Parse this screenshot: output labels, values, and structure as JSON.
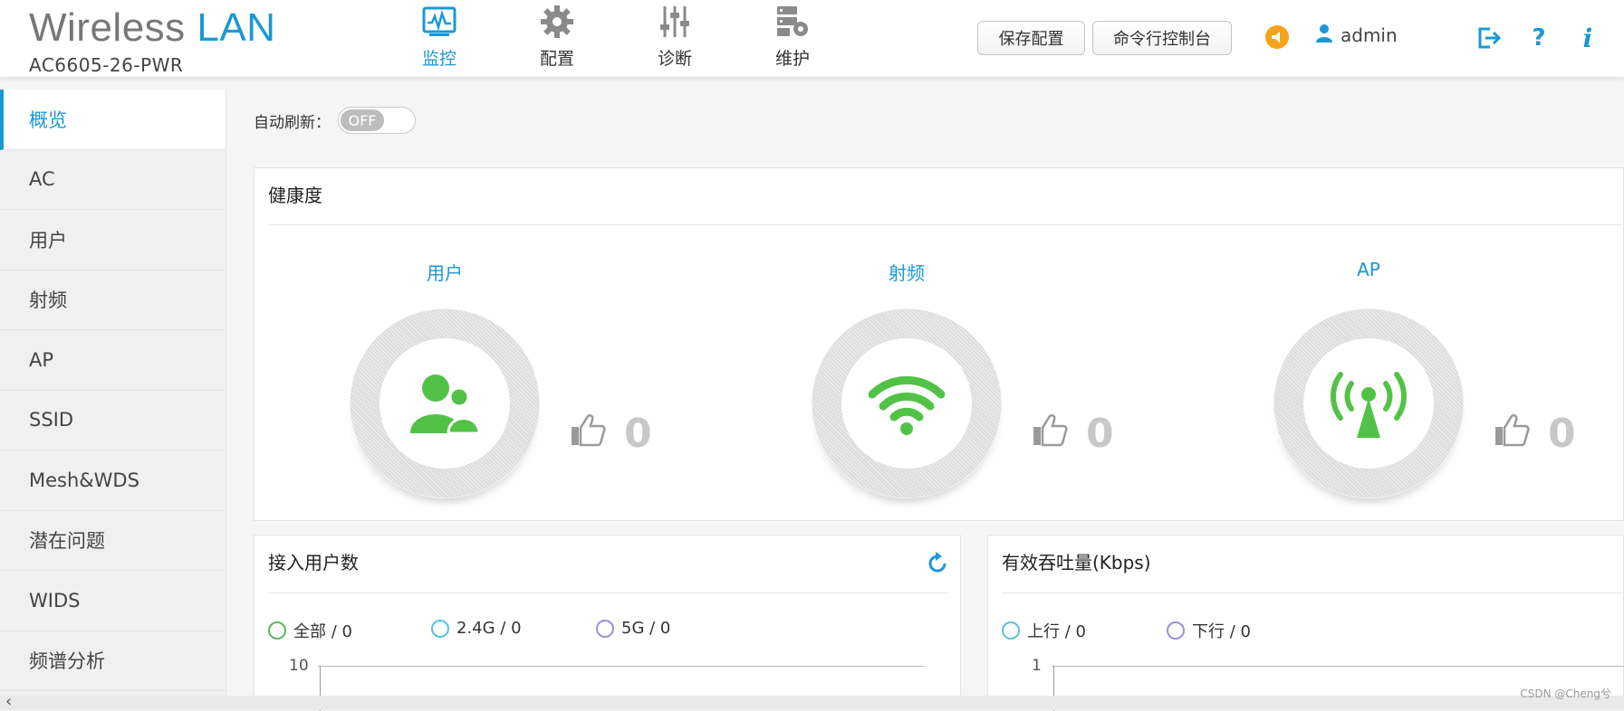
{
  "brand": {
    "title_part1": "Wireless",
    "title_part2": "LAN",
    "model": "AC6605-26-PWR"
  },
  "nav": [
    {
      "label": "监控",
      "icon": "monitor-icon",
      "active": true
    },
    {
      "label": "配置",
      "icon": "gear-icon",
      "active": false
    },
    {
      "label": "诊断",
      "icon": "sliders-icon",
      "active": false
    },
    {
      "label": "维护",
      "icon": "maintenance-icon",
      "active": false
    }
  ],
  "header": {
    "save_label": "保存配置",
    "cli_label": "命令行控制台",
    "user": "admin",
    "help_glyph": "?",
    "info_glyph": "i"
  },
  "sidebar": {
    "items": [
      {
        "label": "概览",
        "active": true
      },
      {
        "label": "AC"
      },
      {
        "label": "用户"
      },
      {
        "label": "射频"
      },
      {
        "label": "AP"
      },
      {
        "label": "SSID"
      },
      {
        "label": "Mesh&WDS"
      },
      {
        "label": "潜在问题"
      },
      {
        "label": "WIDS"
      },
      {
        "label": "频谱分析"
      }
    ]
  },
  "auto_refresh": {
    "label": "自动刷新：",
    "state": "OFF"
  },
  "health": {
    "title": "健康度",
    "cards": [
      {
        "title": "用户",
        "icon": "users-icon",
        "score": "0"
      },
      {
        "title": "射频",
        "icon": "wifi-icon",
        "score": "0"
      },
      {
        "title": "AP",
        "icon": "antenna-icon",
        "score": "0"
      }
    ]
  },
  "access_users": {
    "title": "接入用户数",
    "legend": [
      {
        "label": "全部 / 0",
        "color": "#5cb85c"
      },
      {
        "label": "2.4G / 0",
        "color": "#5bc0de"
      },
      {
        "label": "5G / 0",
        "color": "#9f8fd9"
      }
    ],
    "y_top_tick": "10"
  },
  "throughput": {
    "title": "有效吞吐量(Kbps)",
    "legend": [
      {
        "label": "上行 / 0",
        "color": "#5bc0de"
      },
      {
        "label": "下行 / 0",
        "color": "#9f8fd9"
      }
    ],
    "y_top_tick": "1"
  },
  "watermark": "CSDN @Cheng兮",
  "colors": {
    "accent": "#1a98d5",
    "health_green": "#52c247",
    "alarm": "#f5a31a"
  }
}
